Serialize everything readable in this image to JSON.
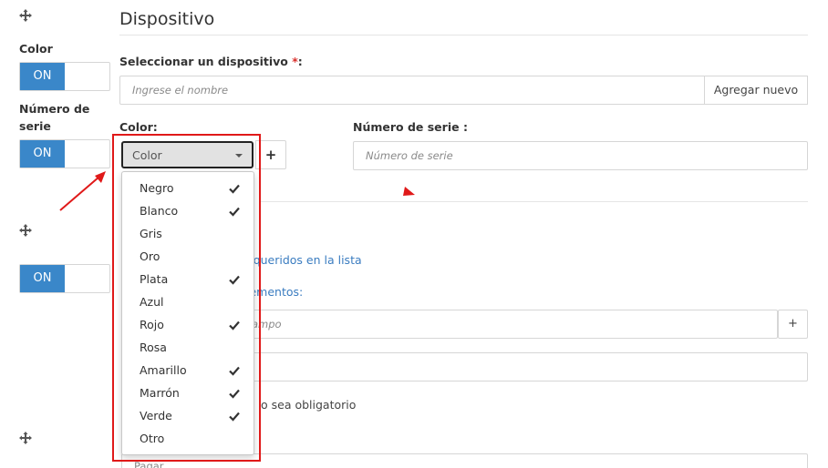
{
  "section": {
    "title": "Dispositivo"
  },
  "sidebar": {
    "color_label": "Color",
    "serial_label_line1": "Número de",
    "serial_label_line2": "serie",
    "toggle_on": "ON"
  },
  "device": {
    "label": "Seleccionar un dispositivo",
    "required_mark": "*",
    "label_suffix": ":",
    "placeholder": "Ingrese el nombre",
    "add_new_label": "Agregar nuevo"
  },
  "color_field": {
    "label": "Color:",
    "selected": "Color",
    "add_symbol": "+"
  },
  "serial_field": {
    "label": "Número de serie :",
    "placeholder": "Número de serie"
  },
  "color_options": [
    {
      "label": "Negro",
      "checked": true
    },
    {
      "label": "Blanco",
      "checked": true
    },
    {
      "label": "Gris",
      "checked": false
    },
    {
      "label": "Oro",
      "checked": false
    },
    {
      "label": "Plata",
      "checked": true
    },
    {
      "label": "Azul",
      "checked": false
    },
    {
      "label": "Rojo",
      "checked": true
    },
    {
      "label": "Rosa",
      "checked": false
    },
    {
      "label": "Amarillo",
      "checked": true
    },
    {
      "label": "Marrón",
      "checked": true
    },
    {
      "label": "Verde",
      "checked": true
    },
    {
      "label": "Otro",
      "checked": false
    }
  ],
  "background": {
    "link_list": "equeridos en la lista",
    "link_elements": "lementos:",
    "field_placeholder": "ampo",
    "plus_symbol": "+",
    "optional_text": "o sea obligatorio",
    "bottom_cut_text": "Pagar"
  },
  "colors": {
    "toggle_on": "#3a87c9",
    "highlight_frame": "#e01919",
    "link": "#3a7cc0"
  }
}
